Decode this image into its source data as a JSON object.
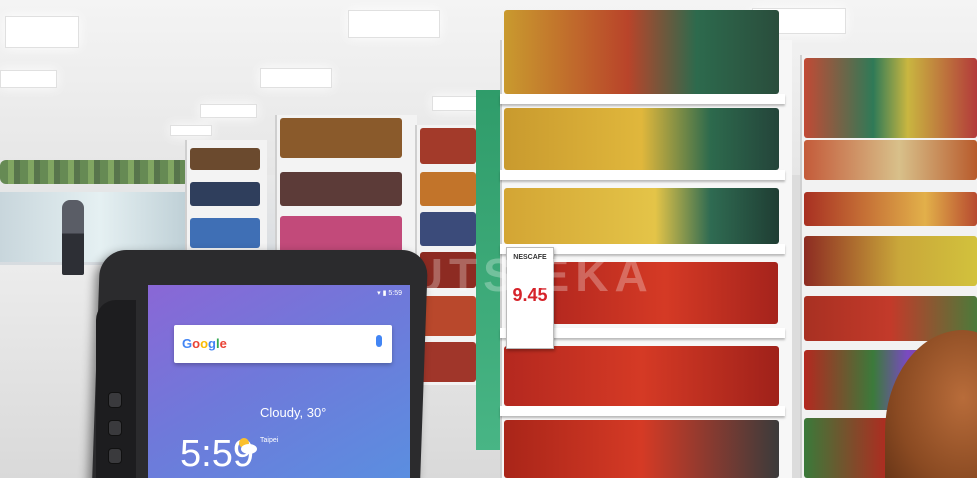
{
  "scene": {
    "description_tag": "supermarket aisle with rugged tablet",
    "colors": {
      "shelf_white": "#f3f3f3",
      "price_red": "#d6232a",
      "screen_start": "#8a67d6",
      "screen_end": "#5a8fe0"
    }
  },
  "price_tag": {
    "brand": "NESCAFE",
    "price": "9.45"
  },
  "tablet": {
    "status_time": "5:59",
    "search_logo": "Google",
    "clock": "5:59",
    "weather_text": "Cloudy, 30°",
    "city": "Taipei",
    "icons": [
      "mic-icon",
      "cloud-sun-icon",
      "wifi-icon",
      "battery-icon"
    ]
  },
  "watermark": {
    "text": "SIMUTSIEKA"
  }
}
